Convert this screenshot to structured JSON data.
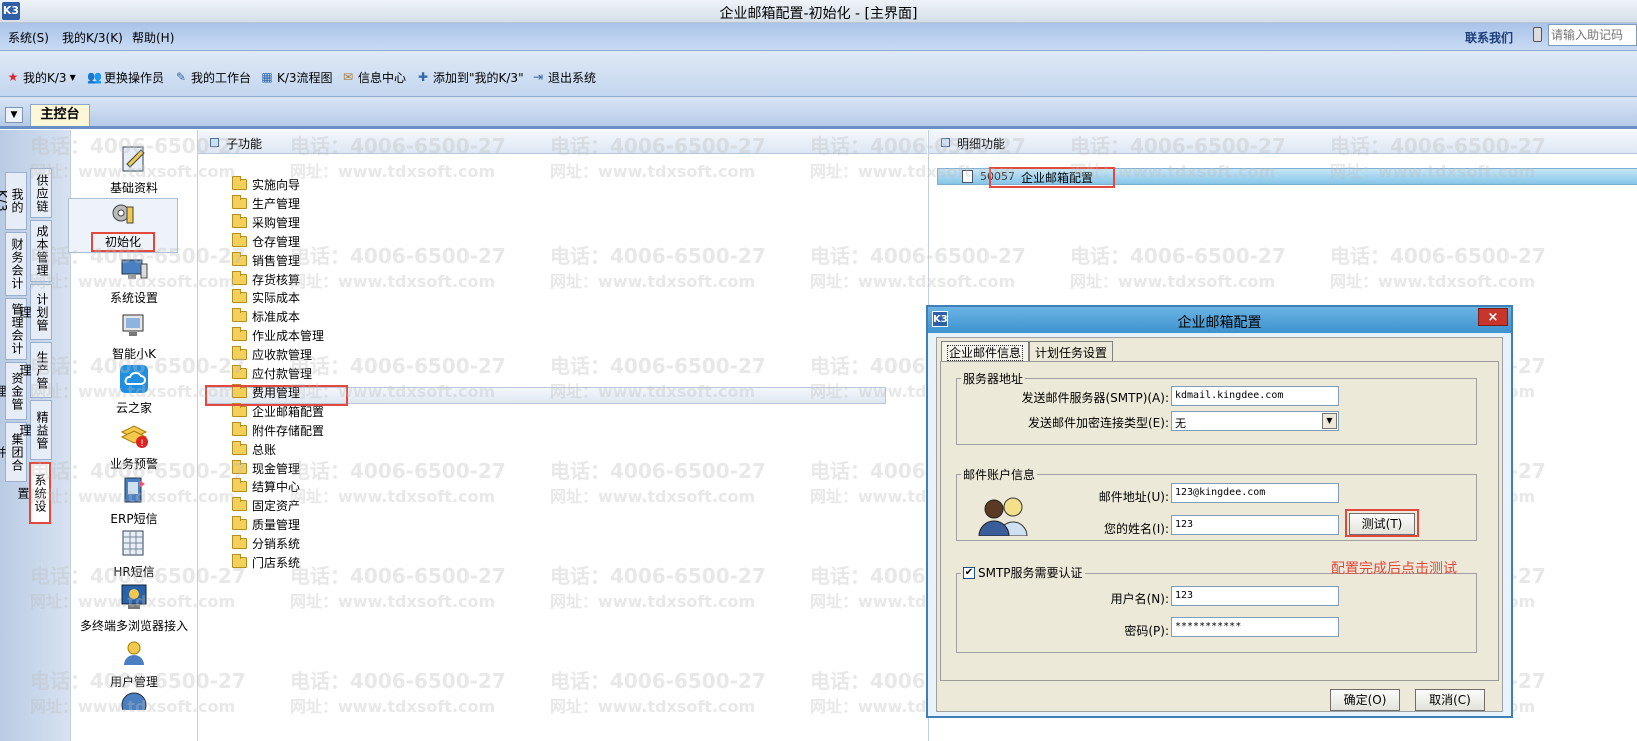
{
  "window": {
    "title": "企业邮箱配置-初始化 - [主界面]",
    "app_icon": "K3"
  },
  "menubar": {
    "items": [
      "系统(S)",
      "我的K/3(K)",
      "帮助(H)"
    ],
    "contact": "联系我们",
    "hint_placeholder": "请输入助记码"
  },
  "toolbar": {
    "items": [
      "我的K/3",
      "更换操作员",
      "我的工作台",
      "K/3流程图",
      "信息中心",
      "添加到\"我的K/3\"",
      "退出系统"
    ]
  },
  "tabs": {
    "main": "主控台"
  },
  "vtabs_left": [
    "我的K/3",
    "财务会计",
    "管理会计",
    "资金管理",
    "集团合并"
  ],
  "vtabs_right": [
    "供应链",
    "成本管理",
    "计划管理",
    "生产管理",
    "精益管理",
    "系统设置"
  ],
  "icon_list": [
    "基础资料",
    "初始化",
    "系统设置",
    "智能小K",
    "云之家",
    "业务预警",
    "ERP短信",
    "HR短信",
    "多终端多浏览器接入",
    "用户管理"
  ],
  "subpanel": {
    "title": "子功能",
    "items": [
      "实施向导",
      "生产管理",
      "采购管理",
      "仓存管理",
      "销售管理",
      "存货核算",
      "实际成本",
      "标准成本",
      "作业成本管理",
      "应收款管理",
      "应付款管理",
      "费用管理",
      "企业邮箱配置",
      "附件存储配置",
      "总账",
      "现金管理",
      "结算中心",
      "固定资产",
      "质量管理",
      "分销系统",
      "门店系统"
    ]
  },
  "detailpanel": {
    "title": "明细功能",
    "item_code": "50057",
    "item_label": "企业邮箱配置"
  },
  "dialog": {
    "title": "企业邮箱配置",
    "close": "×",
    "tabs": [
      "企业邮件信息",
      "计划任务设置"
    ],
    "server_group": "服务器地址",
    "smtp_label": "发送邮件服务器(SMTP)(A):",
    "smtp_value": "kdmail.kingdee.com",
    "encrypt_label": "发送邮件加密连接类型(E):",
    "encrypt_value": "无",
    "account_group": "邮件账户信息",
    "email_label": "邮件地址(U):",
    "email_value": "123@kingdee.com",
    "name_label": "您的姓名(I):",
    "name_value": "123",
    "test_button": "测试(T)",
    "smtp_auth_label": "SMTP服务需要认证",
    "username_label": "用户名(N):",
    "username_value": "123",
    "password_label": "密码(P):",
    "password_value": "***********",
    "ok_button": "确定(O)",
    "cancel_button": "取消(C)"
  },
  "annotation": "配置完成后点击测试",
  "watermark": {
    "phone": "电话：4006-6500-27",
    "site": "网址：www.tdxsoft.com"
  },
  "colors": {
    "highlight": "#e2483b",
    "dialog_title": "#3d92cf",
    "annotation": "#e2483b"
  }
}
